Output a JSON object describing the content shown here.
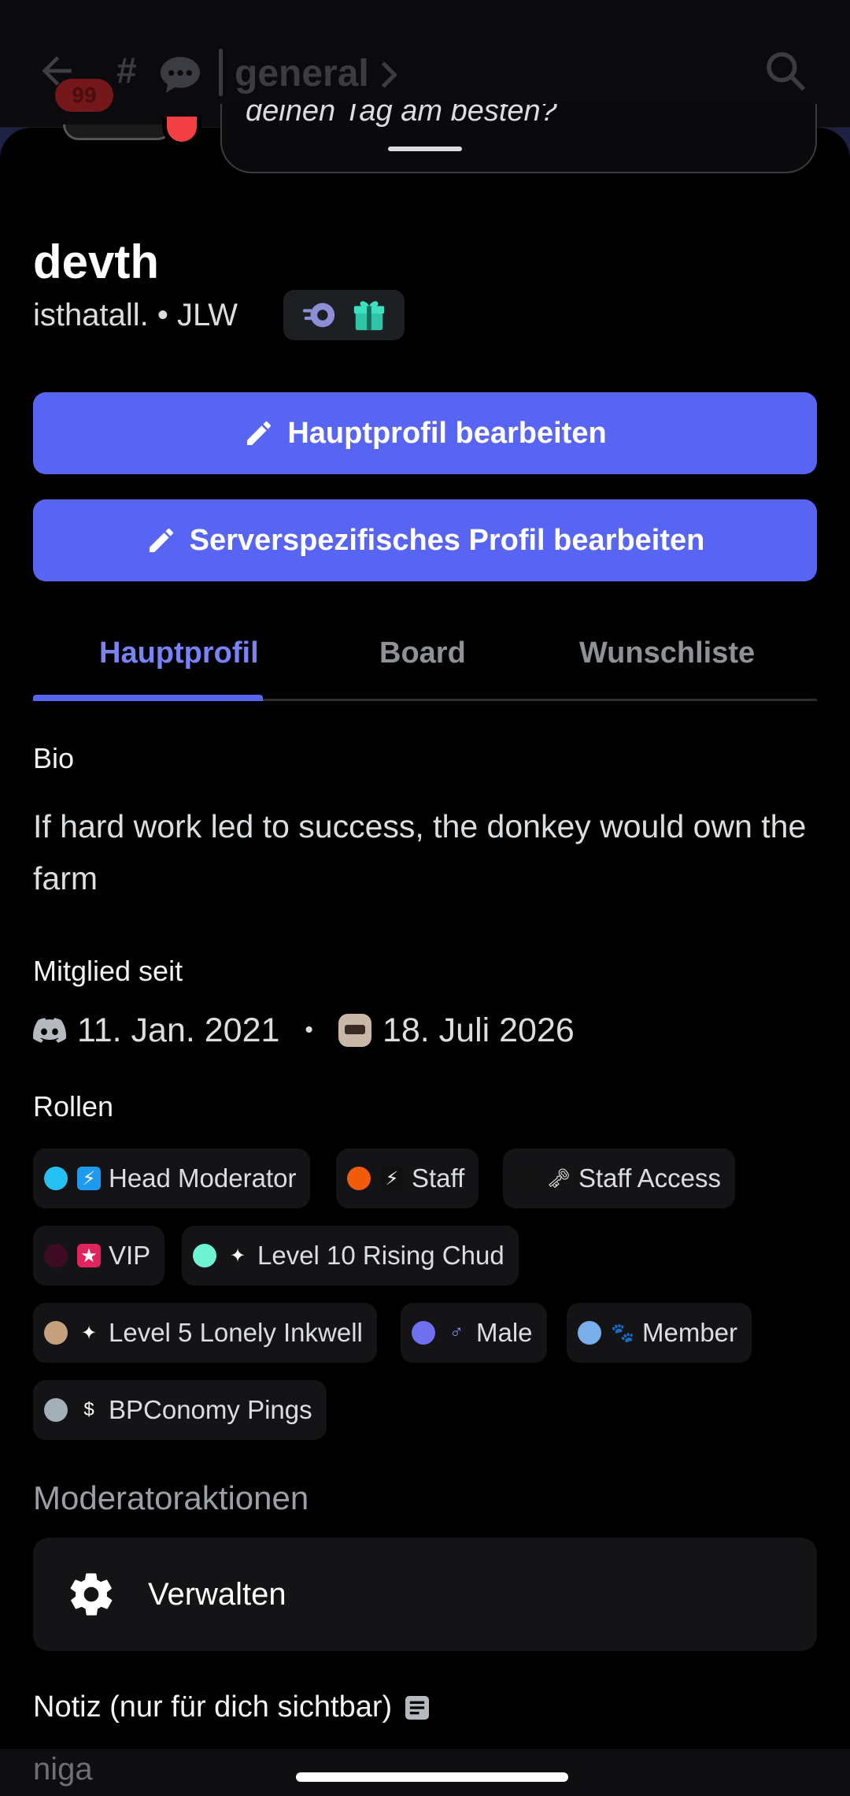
{
  "topbar": {
    "unread_badge": "99",
    "channel_prefix": "#",
    "channel_name": "general"
  },
  "status": {
    "text": "deinen Tag am besten?"
  },
  "profile": {
    "display_name": "devth",
    "username_line": "isthatall. • JLW"
  },
  "buttons": {
    "edit_main": "Hauptprofil bearbeiten",
    "edit_server": "Serverspezifisches Profil bearbeiten"
  },
  "tabs": [
    "Hauptprofil",
    "Board",
    "Wunschliste"
  ],
  "sections": {
    "bio_label": "Bio",
    "bio_text": "If hard work led to success, the donkey would own the farm",
    "member_since_label": "Mitglied seit",
    "discord_joined": "11. Jan. 2021",
    "separator": "•",
    "server_joined": "18. Juli 2026",
    "roles_label": "Rollen"
  },
  "roles": [
    {
      "name": "Head Moderator",
      "dot_color": "#27c0f2",
      "icon": "lightning-badge-icon",
      "icon_glyph": "⚡",
      "icon_bg": "#1e9bf0"
    },
    {
      "name": "Staff",
      "dot_color": "#f25a0c",
      "icon": "lightning-icon",
      "icon_glyph": "⚡",
      "icon_bg": "#111111"
    },
    {
      "name": "Staff Access",
      "dot_color": "#141414",
      "icon": "key-icon",
      "icon_glyph": "🗝",
      "icon_bg": "transparent"
    },
    {
      "name": "VIP",
      "dot_color": "#3d0b22",
      "icon": "star-badge-icon",
      "icon_glyph": "★",
      "icon_bg": "#e0245e"
    },
    {
      "name": "Level 10 Rising Chud",
      "dot_color": "#6ff4d3",
      "icon": "sparkle-icon",
      "icon_glyph": "✦",
      "icon_bg": "transparent"
    },
    {
      "name": "Level 5 Lonely Inkwell",
      "dot_color": "#c7a07f",
      "icon": "sparkle-icon",
      "icon_glyph": "✦",
      "icon_bg": "transparent"
    },
    {
      "name": "Male",
      "dot_color": "#6f70f0",
      "icon": "male-symbol-icon",
      "icon_glyph": "♂",
      "icon_bg": "transparent"
    },
    {
      "name": "Member",
      "dot_color": "#79aee8",
      "icon": "paw-icon",
      "icon_glyph": "🐾",
      "icon_bg": "transparent"
    },
    {
      "name": "BPConomy Pings",
      "dot_color": "#a4b0b8",
      "icon": "dollar-icon",
      "icon_glyph": "$",
      "icon_bg": "transparent"
    }
  ],
  "moderation": {
    "title": "Moderatoraktionen",
    "manage_label": "Verwalten"
  },
  "note": {
    "title": "Notiz (nur für dich sichtbar)",
    "value": "niga"
  },
  "colors": {
    "accent": "#5865f2",
    "tab_active": "#7983f5",
    "status_dnd": "#f23f43"
  }
}
